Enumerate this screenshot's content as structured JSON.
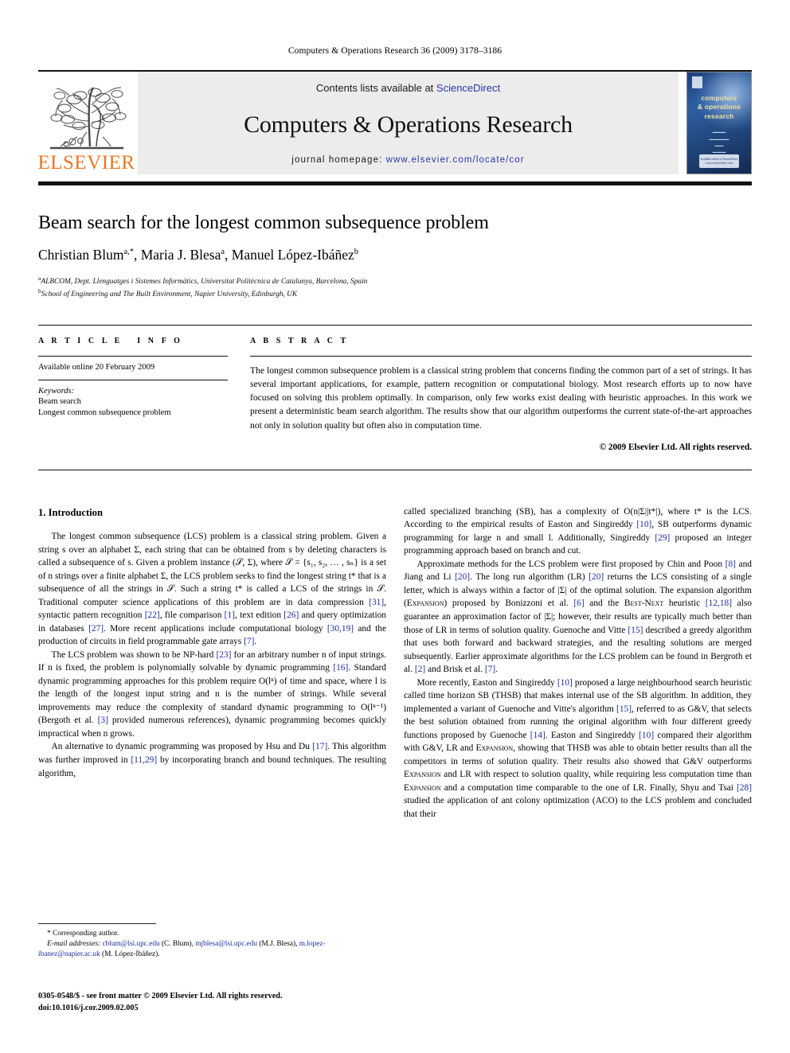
{
  "running_head": "Computers & Operations Research 36 (2009) 3178–3186",
  "masthead": {
    "publisher_name": "ELSEVIER",
    "contents_prefix": "Contents lists available at ",
    "contents_link": "ScienceDirect",
    "journal_title": "Computers & Operations Research",
    "homepage_prefix": "journal homepage: ",
    "homepage_url": "www.elsevier.com/locate/cor",
    "cover": {
      "title_line1": "computers",
      "title_line2": "& operations",
      "title_line3": "research",
      "badge": "Available online at\nScienceDirect\nwww.sciencedirect.com"
    },
    "link_color": "#2a35a8",
    "publisher_color": "#E87722"
  },
  "article": {
    "title": "Beam search for the longest common subsequence problem",
    "authors_html": "Christian Blum<sup>a,*</sup>, Maria J. Blesa<sup>a</sup>, Manuel López-Ibáñez<sup>b</sup>",
    "affiliation_a": "ALBCOM, Dept. Llenguatges i Sistemes Informàtics, Universitat Politècnica de Catalunya, Barcelona, Spain",
    "affiliation_b": "School of Engineering and The Built Environment, Napier University, Edinburgh, UK"
  },
  "article_info": {
    "heading": "ARTICLE INFO",
    "history": "Available online 20 February 2009",
    "keywords_label": "Keywords:",
    "keywords": [
      "Beam search",
      "Longest common subsequence problem"
    ]
  },
  "abstract": {
    "heading": "ABSTRACT",
    "text": "The longest common subsequence problem is a classical string problem that concerns finding the common part of a set of strings. It has several important applications, for example, pattern recognition or computational biology. Most research efforts up to now have focused on solving this problem optimally. In comparison, only few works exist dealing with heuristic approaches. In this work we present a deterministic beam search algorithm. The results show that our algorithm outperforms the current state-of-the-art approaches not only in solution quality but often also in computation time.",
    "copyright": "© 2009 Elsevier Ltd. All rights reserved."
  },
  "body": {
    "section_number_title": "1. Introduction",
    "left_paragraphs": [
      "The longest common subsequence (LCS) problem is a classical string problem. Given a string s over an alphabet Σ, each string that can be obtained from s by deleting characters is called a subsequence of s. Given a problem instance (𝒮, Σ), where 𝒮 = {s₁, s₂, … , sₙ} is a set of n strings over a finite alphabet Σ, the LCS problem seeks to find the longest string t* that is a subsequence of all the strings in 𝒮. Such a string t* is called a LCS of the strings in 𝒮. Traditional computer science applications of this problem are in data compression [31], syntactic pattern recognition [22], file comparison [1], text edition [26] and query optimization in databases [27]. More recent applications include computational biology [30,19] and the production of circuits in field programmable gate arrays [7].",
      "The LCS problem was shown to be NP-hard [23] for an arbitrary number n of input strings. If n is fixed, the problem is polynomially solvable by dynamic programming [16]. Standard dynamic programming approaches for this problem require O(lⁿ) of time and space, where l is the length of the longest input string and n is the number of strings. While several improvements may reduce the complexity of standard dynamic programming to O(lⁿ⁻¹) (Bergoth et al. [3] provided numerous references), dynamic programming becomes quickly impractical when n grows.",
      "An alternative to dynamic programming was proposed by Hsu and Du [17]. This algorithm was further improved in [11,29] by incorporating branch and bound techniques. The resulting algorithm,"
    ],
    "right_paragraphs": [
      "called specialized branching (SB), has a complexity of O(n|Σ||t*|), where t* is the LCS. According to the empirical results of Easton and Singireddy [10], SB outperforms dynamic programming for large n and small l. Additionally, Singireddy [29] proposed an integer programming approach based on branch and cut.",
      "Approximate methods for the LCS problem were first proposed by Chin and Poon [8] and Jiang and Li [20]. The long run algorithm (LR) [20] returns the LCS consisting of a single letter, which is always within a factor of |Σ| of the optimal solution. The expansion algorithm (EXPANSION) proposed by Bonizzoni et al. [6] and the BEST-NEXT heuristic [12,18] also guarantee an approximation factor of |Σ|; however, their results are typically much better than those of LR in terms of solution quality. Guenoche and Vitte [15] described a greedy algorithm that uses both forward and backward strategies, and the resulting solutions are merged subsequently. Earlier approximate algorithms for the LCS problem can be found in Bergroth et al. [2] and Brisk et al. [7].",
      "More recently, Easton and Singireddy [10] proposed a large neighbourhood search heuristic called time horizon SB (THSB) that makes internal use of the SB algorithm. In addition, they implemented a variant of Guenoche and Vitte's algorithm [15], referred to as G&V, that selects the best solution obtained from running the original algorithm with four different greedy functions proposed by Guenoche [14]. Easton and Singireddy [10] compared their algorithm with G&V, LR and EXPANSION, showing that THSB was able to obtain better results than all the competitors in terms of solution quality. Their results also showed that G&V outperforms EXPANSION and LR with respect to solution quality, while requiring less computation time than EXPANSION and a computation time comparable to the one of LR. Finally, Shyu and Tsai [28] studied the application of ant colony optimization (ACO) to the LCS problem and concluded that their"
    ]
  },
  "footnote": {
    "corresponding": "* Corresponding author.",
    "email_label": "E-mail addresses:",
    "emails": [
      {
        "address": "cblum@lsi.upc.edu",
        "owner": "(C. Blum)"
      },
      {
        "address": "mjblesa@lsi.upc.edu",
        "owner": "(M.J. Blesa)"
      },
      {
        "address": "m.lopez-ibanez@napier.ac.uk",
        "owner": "(M. López-Ibáñez)"
      }
    ]
  },
  "imprint": {
    "line1": "0305-0548/$ - see front matter © 2009 Elsevier Ltd. All rights reserved.",
    "line2": "doi:10.1016/j.cor.2009.02.005"
  }
}
